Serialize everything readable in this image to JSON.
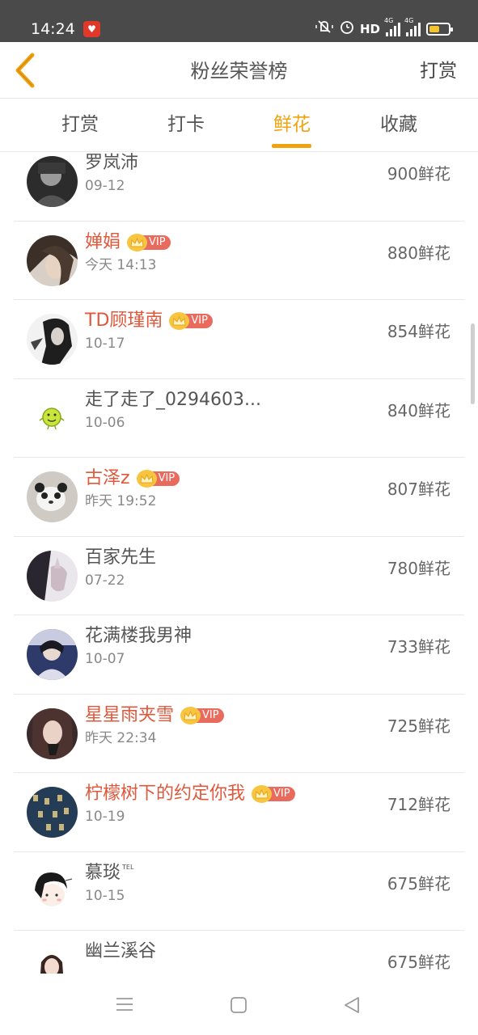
{
  "status_bar": {
    "time": "14:24",
    "app_badge_icon": "heart-app-icon",
    "icons": [
      "mute-vibrate-icon",
      "alarm-icon",
      "hd-icon",
      "signal-4g-icon",
      "signal-4g-icon",
      "battery-icon"
    ],
    "hd_label": "HD",
    "signal_label_1": "4G",
    "signal_label_2": "4G",
    "battery_level": 0.55,
    "battery_color": "#f4c430"
  },
  "header": {
    "title": "粉丝荣誉榜",
    "back_icon": "chevron-left-icon",
    "back_color": "#f2a20f",
    "right_action": "打赏"
  },
  "tabs": {
    "items": [
      {
        "label": "打赏",
        "active": false
      },
      {
        "label": "打卡",
        "active": false
      },
      {
        "label": "鲜花",
        "active": true
      },
      {
        "label": "收藏",
        "active": false
      }
    ],
    "active_color": "#f2a20f"
  },
  "vip_label": "VIP",
  "fans": [
    {
      "name": "罗岚沛",
      "date": "09-12",
      "count": "900鲜花",
      "vip": false,
      "avatar": "dark-portrait"
    },
    {
      "name": "婵娟",
      "date": "今天 14:13",
      "count": "880鲜花",
      "vip": true,
      "avatar": "hair-portrait"
    },
    {
      "name": "TD顾瑾南",
      "date": "10-17",
      "count": "854鲜花",
      "vip": true,
      "avatar": "ink-portrait"
    },
    {
      "name": "走了走了_0294603...",
      "date": "10-06",
      "count": "840鲜花",
      "vip": false,
      "avatar": "smiley"
    },
    {
      "name": "古泽z",
      "date": "昨天 19:52",
      "count": "807鲜花",
      "vip": true,
      "avatar": "panda"
    },
    {
      "name": "百家先生",
      "date": "07-22",
      "count": "780鲜花",
      "vip": false,
      "avatar": "hand-photo"
    },
    {
      "name": "花满楼我男神",
      "date": "10-07",
      "count": "733鲜花",
      "vip": false,
      "avatar": "blue-portrait"
    },
    {
      "name": "星星雨夹雪",
      "date": "昨天 22:34",
      "count": "725鲜花",
      "vip": true,
      "avatar": "girl-portrait"
    },
    {
      "name": "柠檬树下的约定你我",
      "date": "10-19",
      "count": "712鲜花",
      "vip": true,
      "avatar": "text-art"
    },
    {
      "name": "慕琰",
      "name_sup": "TEL",
      "date": "10-15",
      "count": "675鲜花",
      "vip": false,
      "avatar": "cartoon-kid"
    },
    {
      "name": "幽兰溪谷",
      "date": "",
      "count": "675鲜花",
      "vip": false,
      "avatar": "cartoon-girl"
    }
  ],
  "nav_bar": {
    "buttons": [
      "menu-icon",
      "home-square-icon",
      "back-triangle-icon"
    ]
  }
}
